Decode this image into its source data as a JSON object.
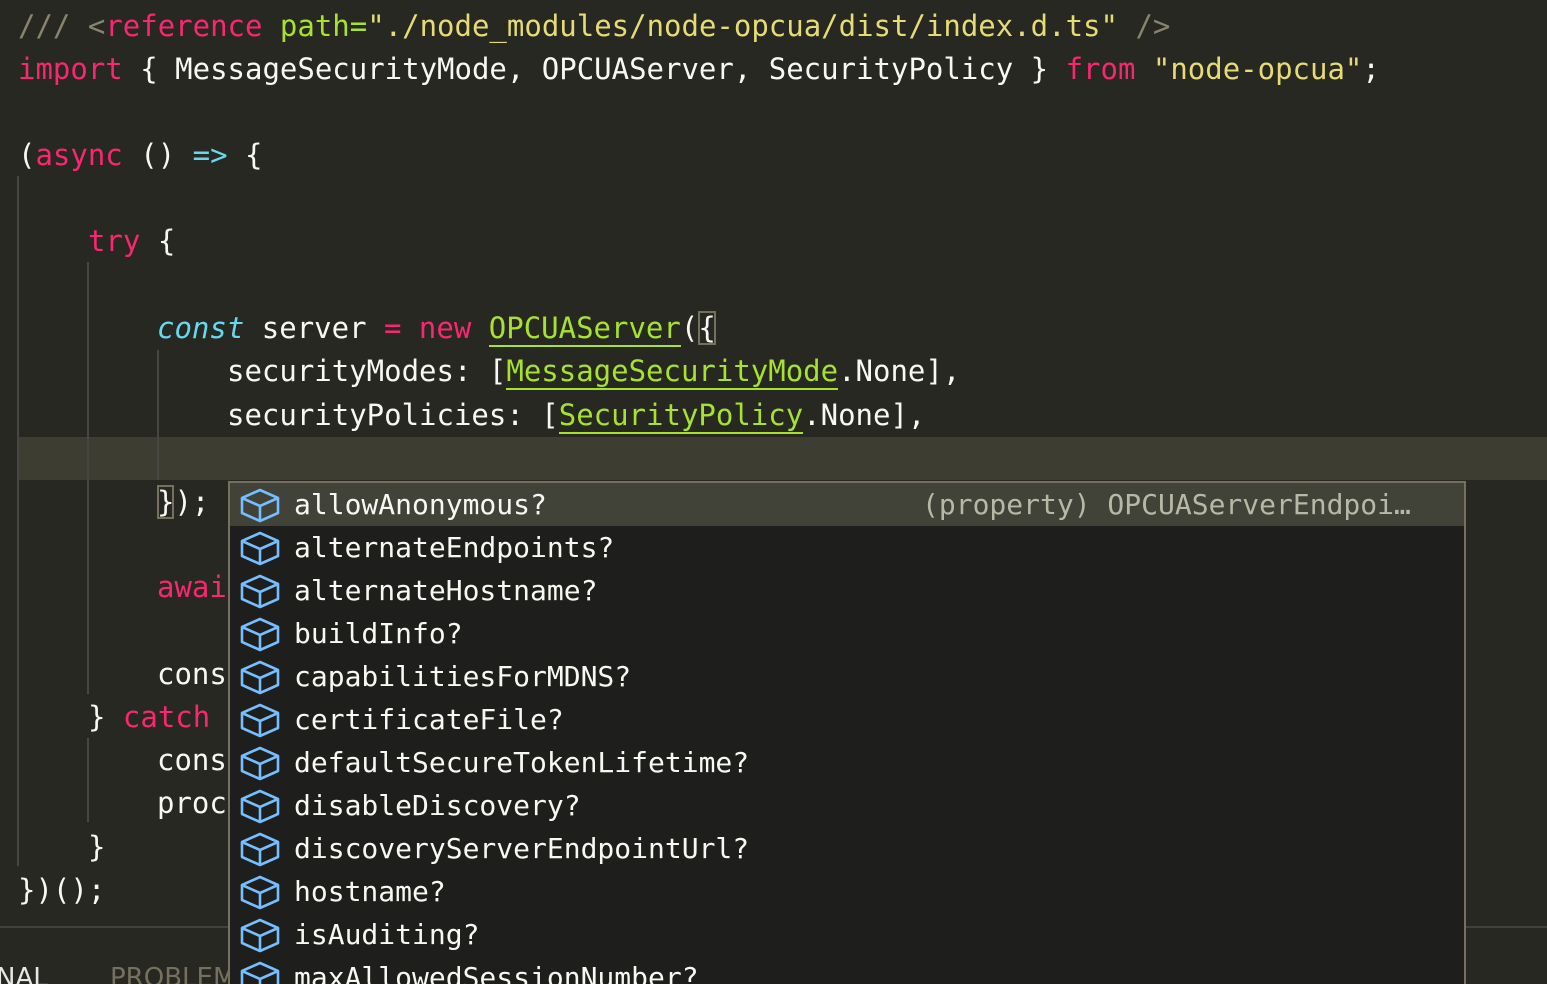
{
  "code": {
    "l1_comment": "/// ",
    "l1_lt": "<",
    "l1_tag": "reference",
    "l1_attr": " path=",
    "l1_path": "\"./node_modules/node-opcua/dist/index.d.ts\"",
    "l1_close": " />",
    "l2_import": "import",
    "l2_names": " { MessageSecurityMode, OPCUAServer, SecurityPolicy } ",
    "l2_from": "from",
    "l2_module": " \"node-opcua\"",
    "l2_semi": ";",
    "l4_paren": "(",
    "l4_async": "async",
    "l4_args": " () ",
    "l4_arrow": "=>",
    "l4_brace": " {",
    "l6_try": "try",
    "l6_brace": " {",
    "l8_const": "const",
    "l8_var": " server ",
    "l8_eq": "=",
    "l8_new": " new",
    "l8_sp": " ",
    "l8_class": "OPCUAServer",
    "l8_paren": "(",
    "l8_brace": "{",
    "l9_key": "securityModes: [",
    "l9_enum": "MessageSecurityMode",
    "l9_rest": ".None],",
    "l10_key": "securityPolicies: [",
    "l10_enum": "SecurityPolicy",
    "l10_rest": ".None],",
    "l12_brace": "}",
    "l12_rest": ");",
    "l14_await": "awai",
    "l16_cons": "cons",
    "l17_brace": "} ",
    "l17_catch": "catch",
    "l18_cons": "cons",
    "l19_proc": "proc",
    "l20_brace": "}",
    "l21_end": "})();"
  },
  "panel_tabs": {
    "terminal": "NAL",
    "problems": "PROBLEM"
  },
  "suggestions": {
    "detail": "(property) OPCUAServerEndpoi…",
    "items": [
      "allowAnonymous?",
      "alternateEndpoints?",
      "alternateHostname?",
      "buildInfo?",
      "capabilitiesForMDNS?",
      "certificateFile?",
      "defaultSecureTokenLifetime?",
      "disableDiscovery?",
      "discoveryServerEndpointUrl?",
      "hostname?",
      "isAuditing?",
      "maxAllowedSessionNumber?"
    ],
    "item_icon": "property-cube-icon",
    "icon_color": "#75beff"
  },
  "theme": {
    "background": "#272822",
    "keyword": "#f92672",
    "string": "#e6db74",
    "class": "#a6e22e",
    "storage": "#66d9ef"
  }
}
